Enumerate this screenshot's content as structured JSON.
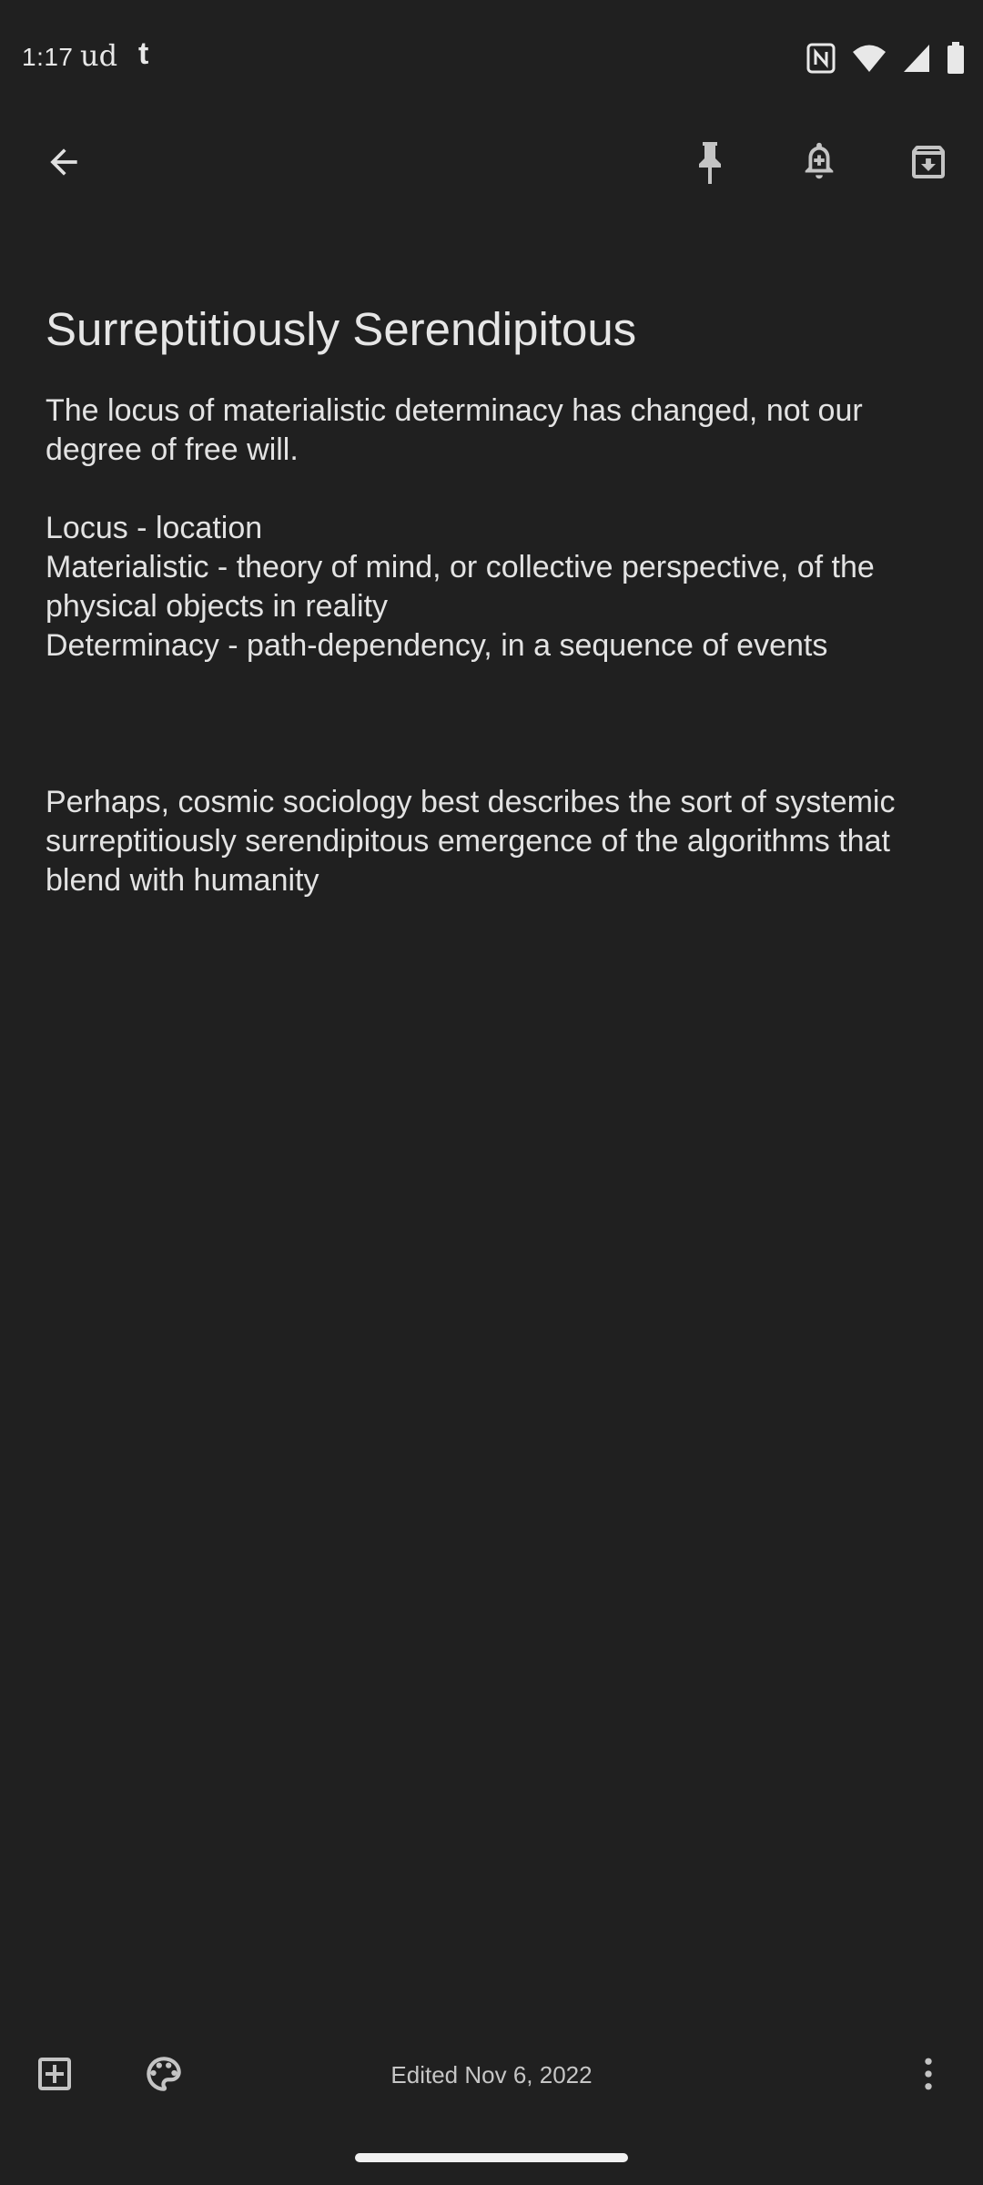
{
  "status_bar": {
    "time": "1:17",
    "app_indicator_1": "ud",
    "app_indicator_2": "t",
    "icons": [
      "nfc-icon",
      "wifi-icon",
      "signal-icon",
      "battery-icon"
    ]
  },
  "toolbar": {
    "back_icon": "arrow-back-icon",
    "pin_icon": "pin-icon",
    "reminder_icon": "add-alert-icon",
    "archive_icon": "archive-icon"
  },
  "note": {
    "title": "Surreptitiously Serendipitous",
    "body": "The locus of materialistic determinacy has changed, not our degree of free will.\n\nLocus - location\nMaterialistic - theory of mind, or collective perspective, of the physical objects in reality\nDeterminacy - path-dependency, in a sequence of events\n\n\n\nPerhaps, cosmic sociology best describes the sort of systemic surreptitiously serendipitous emergence of the algorithms that blend with humanity"
  },
  "bottom_bar": {
    "add_icon": "add-box-icon",
    "palette_icon": "palette-icon",
    "edited_label": "Edited Nov 6, 2022",
    "more_icon": "more-vert-icon"
  },
  "colors": {
    "background": "#202020",
    "text": "#e3e3e3",
    "icon": "#c4c4c4"
  }
}
